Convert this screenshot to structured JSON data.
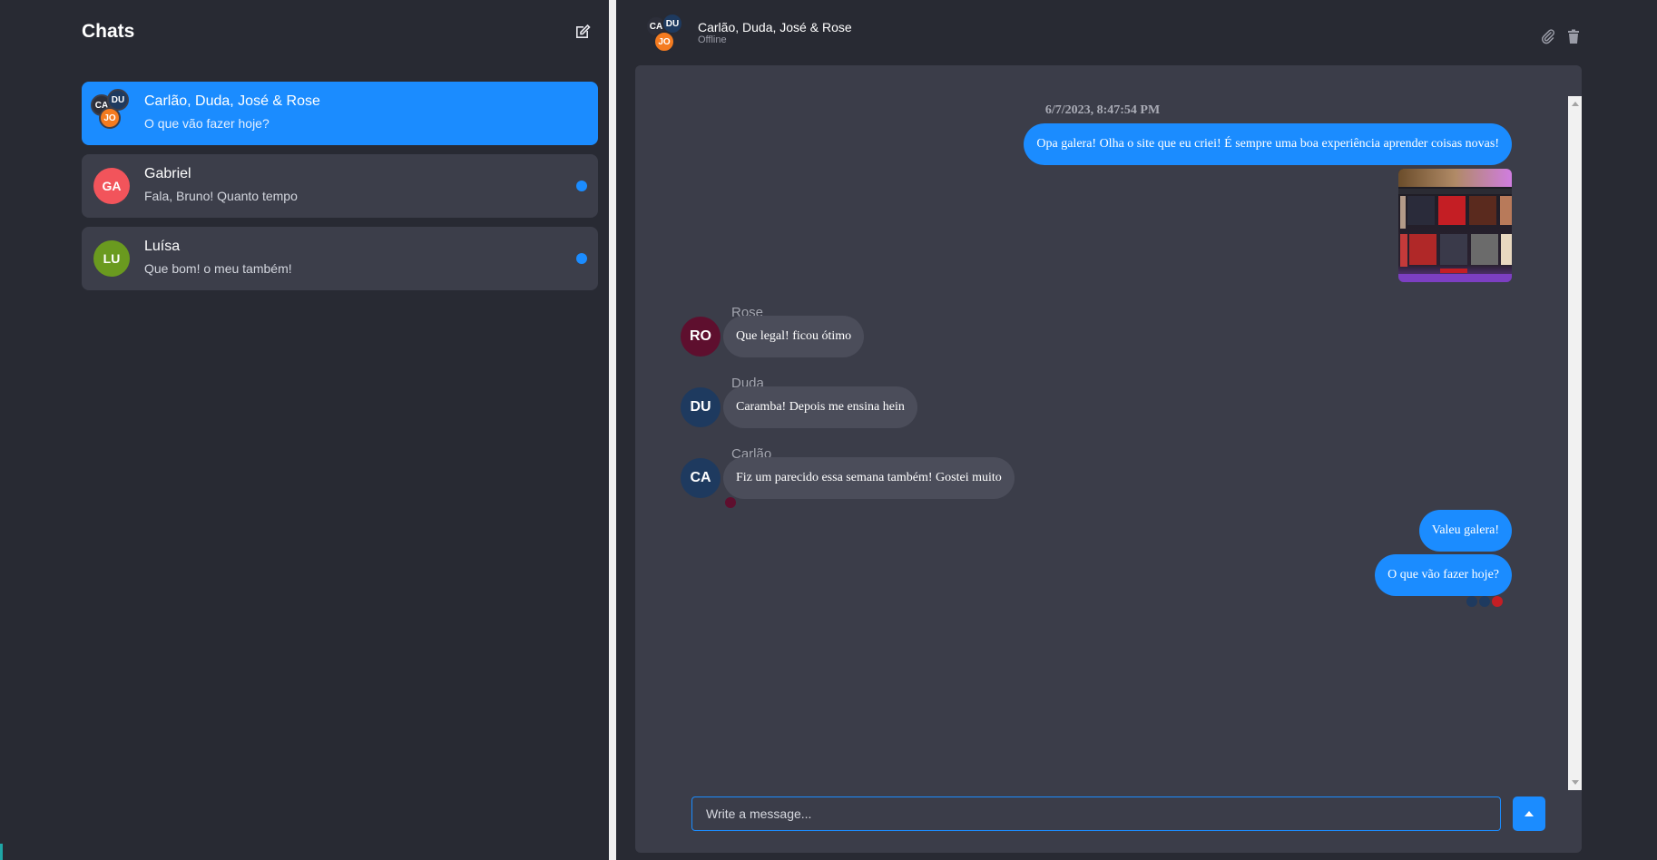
{
  "sidebar": {
    "title": "Chats",
    "chats": [
      {
        "name": "Carlão, Duda, José & Rose",
        "last_message": "O que vão fazer hoje?",
        "active": true,
        "unread": false,
        "avatars": [
          {
            "initials": "CA",
            "color": "#2d2f3a"
          },
          {
            "initials": "DU",
            "color": "#1e3a5f"
          },
          {
            "initials": "JO",
            "color": "#f47b20"
          }
        ]
      },
      {
        "name": "Gabriel",
        "last_message": "Fala, Bruno! Quanto tempo",
        "active": false,
        "unread": true,
        "avatars": [
          {
            "initials": "GA",
            "color": "#f2545b"
          }
        ]
      },
      {
        "name": "Luísa",
        "last_message": "Que bom! o meu também!",
        "active": false,
        "unread": true,
        "avatars": [
          {
            "initials": "LU",
            "color": "#6a9a1f"
          }
        ]
      }
    ]
  },
  "conversation": {
    "title": "Carlão, Duda, José & Rose",
    "status": "Offline",
    "avatars": [
      {
        "initials": "CA",
        "color": "#2d2f3a"
      },
      {
        "initials": "DU",
        "color": "#1e3a5f"
      },
      {
        "initials": "JO",
        "color": "#f47b20"
      }
    ],
    "date": "6/7/2023, 8:47:54 PM",
    "messages": [
      {
        "text": "Opa galera! Olha o site que eu criei! É sempre uma boa experiência aprender coisas novas!",
        "outgoing": true
      },
      {
        "sender": "Rose",
        "initials": "RO",
        "color": "#5e0f2e",
        "text": "Que legal! ficou ótimo"
      },
      {
        "sender": "Duda",
        "initials": "DU",
        "color": "#1e3a5f",
        "text": "Caramba! Depois me ensina hein"
      },
      {
        "sender": "Carlão",
        "initials": "CA",
        "color": "#1e3a5f",
        "text": "Fiz um parecido essa semana também! Gostei muito"
      },
      {
        "text": "Valeu galera!",
        "outgoing": true
      },
      {
        "text": "O que vão fazer hoje?",
        "outgoing": true
      }
    ],
    "composer_placeholder": "Write a message..."
  },
  "colors": {
    "accent": "#1b8cff",
    "background": "#282a33",
    "panel": "#3b3d49"
  },
  "icons": [
    "compose-icon",
    "paperclip-icon",
    "trash-icon",
    "send-arrow-icon"
  ]
}
